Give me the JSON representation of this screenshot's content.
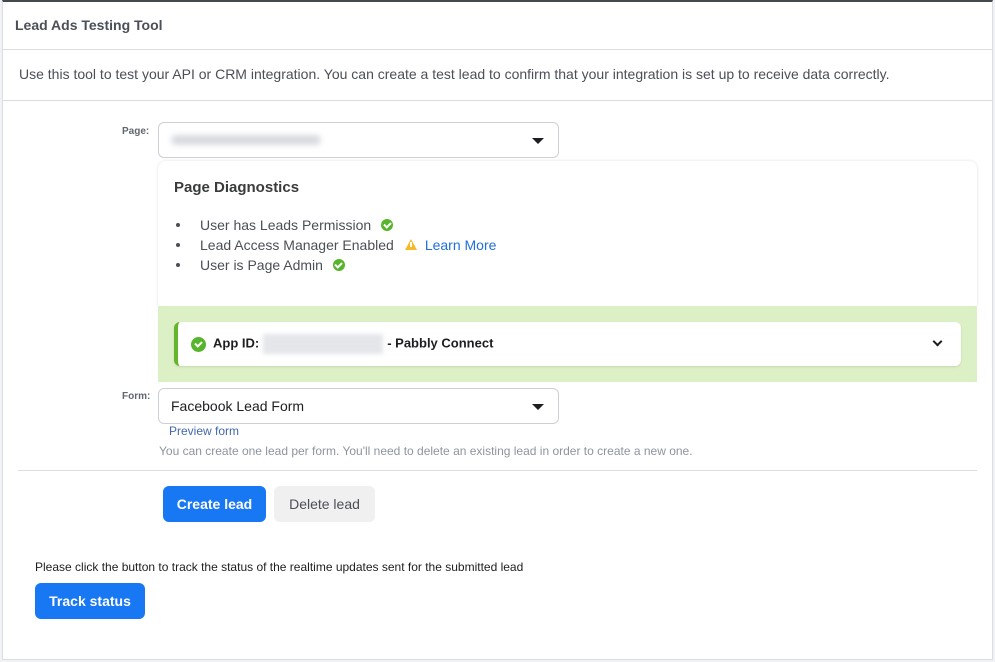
{
  "header": {
    "title": "Lead Ads Testing Tool"
  },
  "intro": {
    "text": "Use this tool to test your API or CRM integration. You can create a test lead to confirm that your integration is set up to receive data correctly."
  },
  "page_field": {
    "label": "Page:",
    "value_obscured": true
  },
  "diagnostics": {
    "title": "Page Diagnostics",
    "items": [
      {
        "label": "User has Leads Permission",
        "status": "ok",
        "icon": "check-circle-icon"
      },
      {
        "label": "Lead Access Manager Enabled",
        "status": "warning",
        "icon": "warning-icon",
        "link": "Learn More"
      },
      {
        "label": "User is Page Admin",
        "status": "ok",
        "icon": "check-circle-icon"
      }
    ]
  },
  "app": {
    "prefix": "App ID:",
    "id_obscured": true,
    "suffix": "- Pabbly Connect"
  },
  "form_field": {
    "label": "Form:",
    "value": "Facebook Lead Form",
    "preview_link": "Preview form",
    "hint": "You can create one lead per form. You'll need to delete an existing lead in order to create a new one."
  },
  "actions": {
    "create_label": "Create lead",
    "delete_label": "Delete lead"
  },
  "tracking": {
    "text": "Please click the button to track the status of the realtime updates sent for the submitted lead",
    "button_label": "Track status"
  },
  "colors": {
    "primary": "#1877f2",
    "success": "#57b52c",
    "warning": "#f7b928",
    "success_band": "#dcf0c5"
  }
}
